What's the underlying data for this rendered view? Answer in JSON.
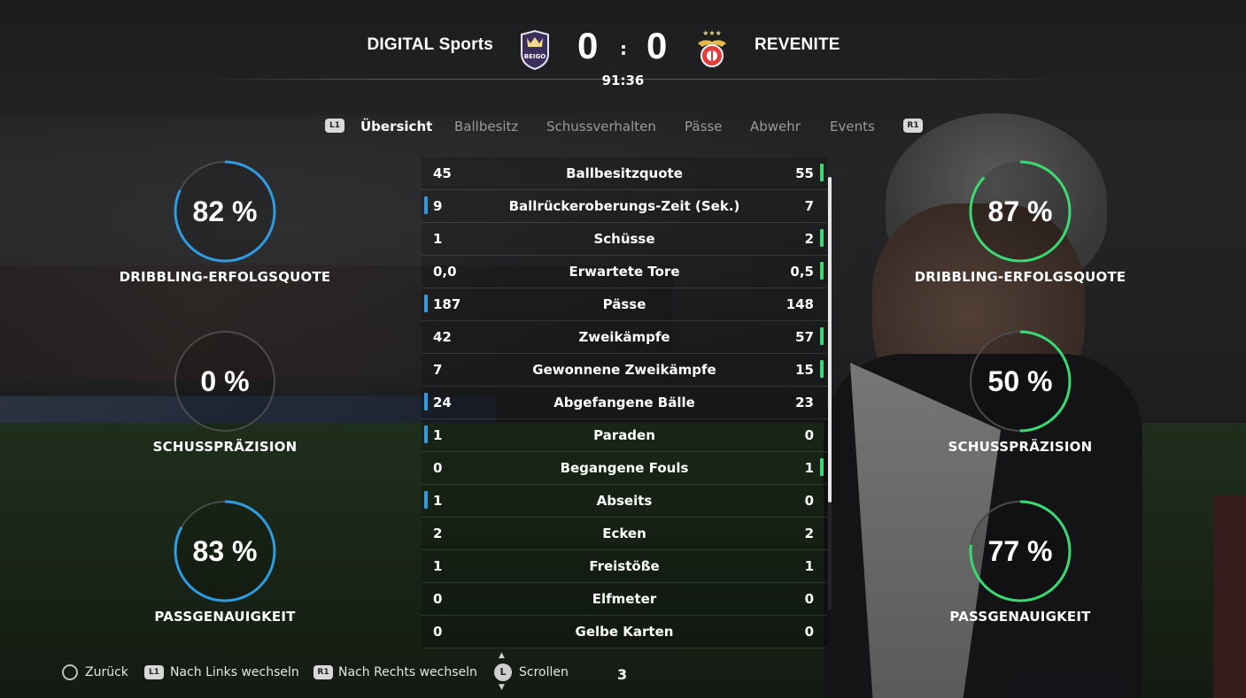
{
  "header": {
    "home_team": "DIGITAL Sports",
    "away_team": "REVENITE",
    "home_score": "0",
    "away_score": "0",
    "separator": ":",
    "clock": "91:36",
    "home_crest_text": "BEIGO"
  },
  "tabs": {
    "left_button": "L1",
    "right_button": "R1",
    "items": [
      "Übersicht",
      "Ballbesitz",
      "Schussverhalten",
      "Pässe",
      "Abwehr",
      "Events"
    ],
    "active_index": 0
  },
  "stats": [
    {
      "label": "Ballbesitzquote",
      "home": "45",
      "away": "55",
      "leader": "away"
    },
    {
      "label": "Ballrückeroberungs-Zeit (Sek.)",
      "home": "9",
      "away": "7",
      "leader": "home"
    },
    {
      "label": "Schüsse",
      "home": "1",
      "away": "2",
      "leader": "away"
    },
    {
      "label": "Erwartete Tore",
      "home": "0,0",
      "away": "0,5",
      "leader": "away"
    },
    {
      "label": "Pässe",
      "home": "187",
      "away": "148",
      "leader": "home"
    },
    {
      "label": "Zweikämpfe",
      "home": "42",
      "away": "57",
      "leader": "away"
    },
    {
      "label": "Gewonnene Zweikämpfe",
      "home": "7",
      "away": "15",
      "leader": "away"
    },
    {
      "label": "Abgefangene Bälle",
      "home": "24",
      "away": "23",
      "leader": "home"
    },
    {
      "label": "Paraden",
      "home": "1",
      "away": "0",
      "leader": "home"
    },
    {
      "label": "Begangene Fouls",
      "home": "0",
      "away": "1",
      "leader": "away"
    },
    {
      "label": "Abseits",
      "home": "1",
      "away": "0",
      "leader": "home"
    },
    {
      "label": "Ecken",
      "home": "2",
      "away": "2",
      "leader": "none"
    },
    {
      "label": "Freistöße",
      "home": "1",
      "away": "1",
      "leader": "none"
    },
    {
      "label": "Elfmeter",
      "home": "0",
      "away": "0",
      "leader": "none"
    },
    {
      "label": "Gelbe Karten",
      "home": "0",
      "away": "0",
      "leader": "none"
    }
  ],
  "rings": {
    "home": [
      {
        "value": "82 %",
        "percent": 82,
        "label": "DRIBBLING-ERFOLGSQUOTE"
      },
      {
        "value": "0 %",
        "percent": 0,
        "label": "SCHUSSPRÄZISION"
      },
      {
        "value": "83 %",
        "percent": 83,
        "label": "PASSGENAUIGKEIT"
      }
    ],
    "away": [
      {
        "value": "87 %",
        "percent": 87,
        "label": "DRIBBLING-ERFOLGSQUOTE"
      },
      {
        "value": "50 %",
        "percent": 50,
        "label": "SCHUSSPRÄZISION"
      },
      {
        "value": "77 %",
        "percent": 77,
        "label": "PASSGENAUIGKEIT"
      }
    ]
  },
  "colors": {
    "home_accent": "#2f9be0",
    "away_accent": "#3ad973",
    "ring_track": "#4a4a4a"
  },
  "scroll_fraction": 0.75,
  "footer": {
    "back": "Zurück",
    "left_button": "L1",
    "left_label": "Nach Links wechseln",
    "right_button": "R1",
    "right_label": "Nach Rechts wechseln",
    "stick": "L",
    "scroll_label": "Scrollen",
    "page": "3"
  }
}
